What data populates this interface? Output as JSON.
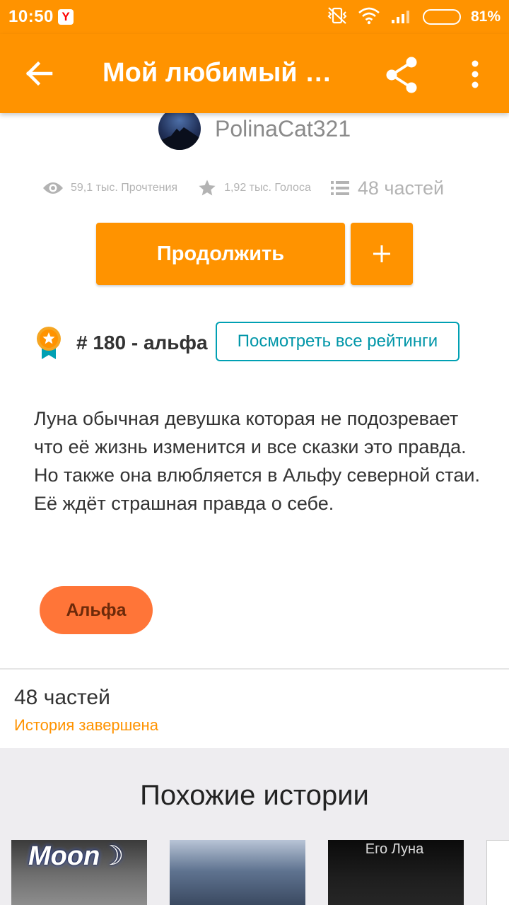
{
  "status_bar": {
    "time": "10:50",
    "yandex_badge": "Y",
    "battery_percent": "81%",
    "icons": [
      "vibrate-off-icon",
      "wifi-icon",
      "signal-icon",
      "battery-icon"
    ]
  },
  "app_bar": {
    "title": "Мой любимый Альфа",
    "back_icon": "arrow-left-icon",
    "share_icon": "share-icon",
    "more_icon": "more-vertical-icon",
    "color": "#ff9300"
  },
  "author": {
    "name": "PolinaCat321"
  },
  "stats": {
    "reads": "59,1 тыс. Прочтения",
    "votes": "1,92 тыс. Голоса",
    "parts": "48 частей"
  },
  "actions": {
    "continue_label": "Продолжить",
    "add_label": "+"
  },
  "ranking": {
    "rank_text": "# 180 - альфа",
    "view_all_label": "Посмотреть все рейтинги",
    "accent": "#00a0b3"
  },
  "description": "Луна обычная девушка которая не подозревает что её жизнь изменится и все сказки это правда. Но также она влюбляется в Альфу северной стаи.\nЕё ждёт страшная правда о себе.",
  "tags": [
    "Альфа"
  ],
  "parts_info": {
    "count_label": "48 частей",
    "status": "История завершена"
  },
  "similar": {
    "title": "Похожие истории",
    "covers": [
      {
        "overlay_text": "Moon☽"
      },
      {
        "overlay_text": ""
      },
      {
        "overlay_text": "Его Луна"
      },
      {
        "overlay_text": ""
      }
    ]
  }
}
